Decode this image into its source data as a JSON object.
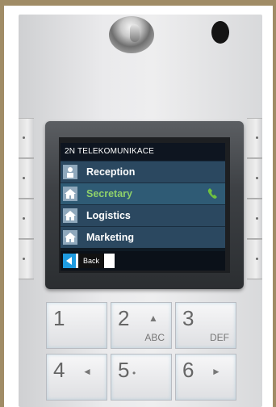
{
  "screen": {
    "header": "2N TELEKOMUNIKACE",
    "rows": [
      {
        "label": "Reception",
        "icon": "person-icon",
        "selected": false
      },
      {
        "label": "Secretary",
        "icon": "home-icon",
        "selected": true,
        "call_icon": "phone-handset-icon"
      },
      {
        "label": "Logistics",
        "icon": "home-icon",
        "selected": false
      },
      {
        "label": "Marketing",
        "icon": "home-icon",
        "selected": false
      }
    ],
    "back_label": "Back",
    "back_icon": "back-arrow-icon"
  },
  "keypad": {
    "keys": [
      {
        "digit": "1",
        "letters": "",
        "arrow": ""
      },
      {
        "digit": "2",
        "letters": "ABC",
        "arrow": "▲"
      },
      {
        "digit": "3",
        "letters": "DEF",
        "arrow": ""
      },
      {
        "digit": "4",
        "letters": "",
        "arrow": "◄"
      },
      {
        "digit": "5",
        "letters": "",
        "arrow": "•"
      },
      {
        "digit": "6",
        "letters": "",
        "arrow": "►"
      }
    ]
  },
  "colors": {
    "frame": "#a08c66",
    "row_bg": "#2b4860",
    "selected_text": "#8fd16a",
    "back_accent": "#1e9be0"
  }
}
